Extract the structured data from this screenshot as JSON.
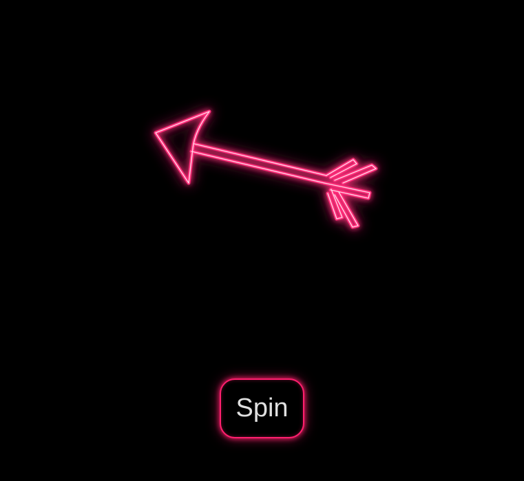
{
  "spinner": {
    "icon": "arrow-icon",
    "glow_color": "#ff2d7a",
    "line_color": "#ff5a9e"
  },
  "spin_button": {
    "label": "Spin",
    "border_color": "#ff1f6e",
    "text_color": "#e0e0e0"
  },
  "background_color": "#000000"
}
